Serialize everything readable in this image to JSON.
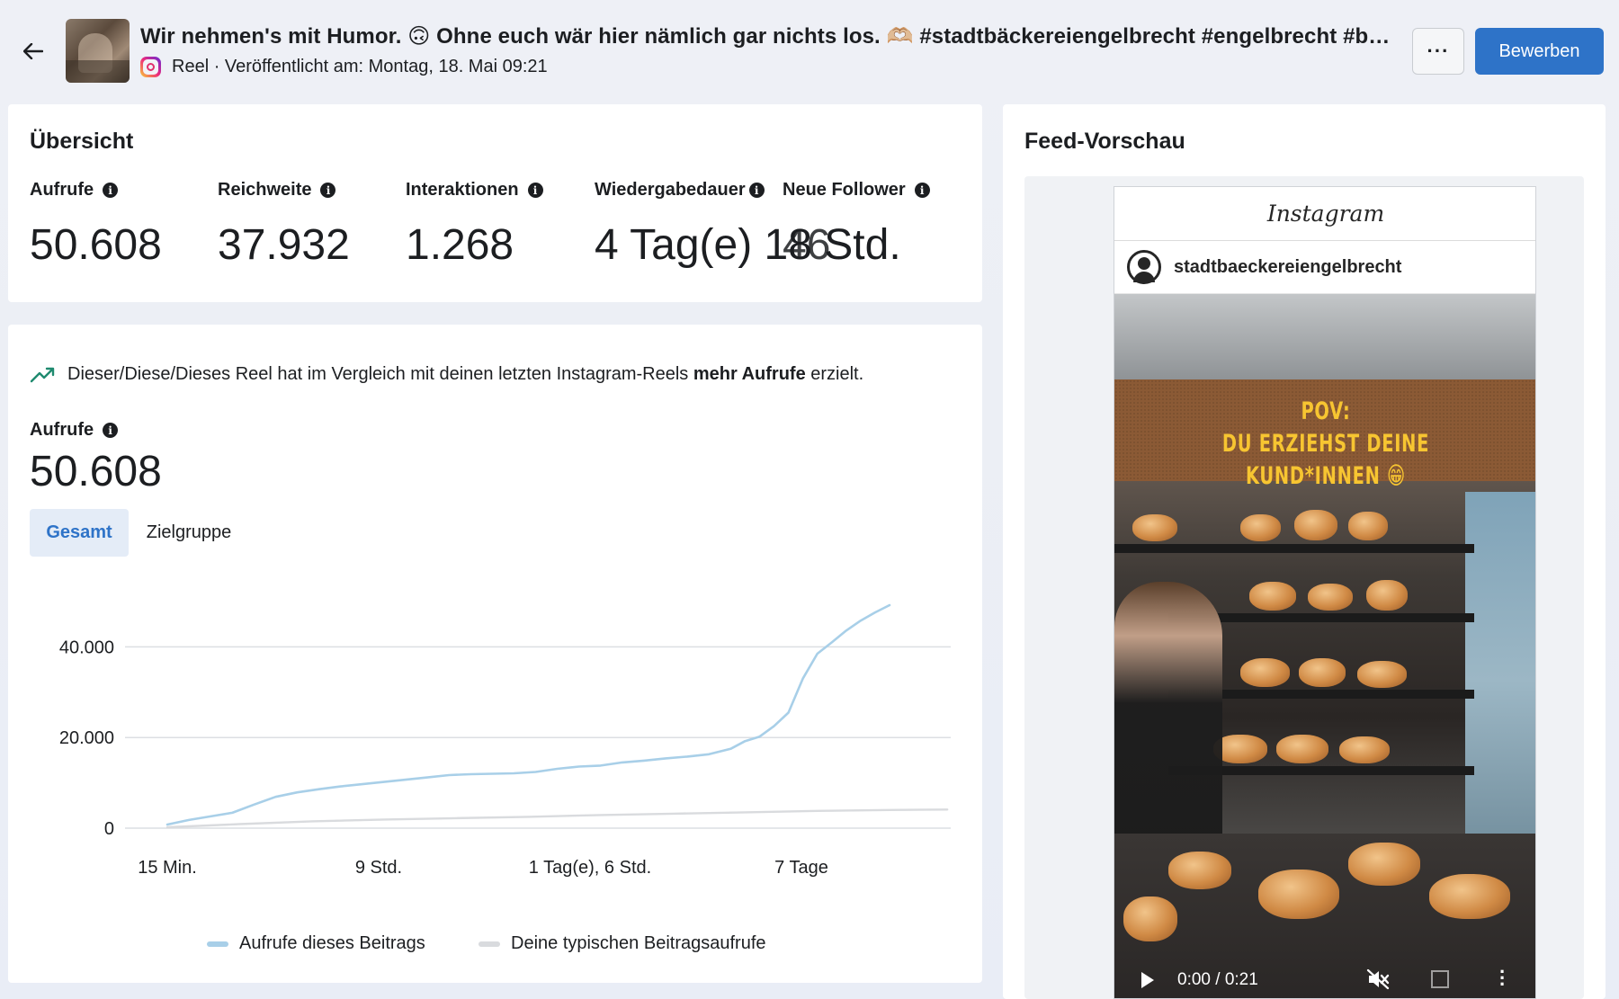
{
  "header": {
    "post_title": "Wir nehmen's mit Humor. 🙃 Ohne euch wär hier nämlich gar nichts los. 🫶🏼 #stadtbäckereiengelbrecht #engelbrecht #bremerha...",
    "meta": "Reel · Veröffentlicht am: Montag, 18. Mai 09:21",
    "more_label": "···",
    "apply_label": "Bewerben"
  },
  "overview": {
    "title": "Übersicht",
    "metrics": [
      {
        "label": "Aufrufe",
        "value": "50.608"
      },
      {
        "label": "Reichweite",
        "value": "37.932"
      },
      {
        "label": "Interaktionen",
        "value": "1.268"
      },
      {
        "label": "Wiedergabedauer",
        "value": "4 Tag(e) 18 Std."
      },
      {
        "label": "Neue Follower",
        "value": "46"
      }
    ]
  },
  "performance": {
    "trend_text_before": "Dieser/Diese/Dieses Reel hat im Vergleich mit deinen letzten Instagram-Reels",
    "trend_text_bold": "mehr Aufrufe",
    "trend_text_after": "erzielt.",
    "views_label": "Aufrufe",
    "views_value": "50.608",
    "tabs": [
      "Gesamt",
      "Zielgruppe"
    ],
    "active_tab": "Gesamt"
  },
  "chart_data": {
    "type": "line",
    "x_ticks": [
      "15 Min.",
      "9 Std.",
      "1 Tag(e), 6 Std.",
      "7 Tage"
    ],
    "y_ticks": [
      "0",
      "20.000",
      "40.000"
    ],
    "ylim": [
      0,
      50000
    ],
    "grid": true,
    "legend_position": "bottom",
    "series": [
      {
        "name": "Aufrufe dieses Beitrags",
        "color": "#a8cfe8",
        "x": [
          0,
          3,
          6,
          9,
          12,
          15,
          18,
          21,
          24,
          27,
          30,
          33,
          36,
          39,
          42,
          45,
          48,
          51,
          54,
          57,
          60,
          63,
          66,
          69,
          72,
          75,
          78,
          80,
          82,
          84,
          86,
          88,
          90,
          92,
          94,
          96,
          98,
          100
        ],
        "y": [
          800,
          1800,
          2600,
          3400,
          5200,
          6900,
          7900,
          8600,
          9200,
          9700,
          10200,
          10700,
          11200,
          11700,
          11900,
          12000,
          12100,
          12400,
          13100,
          13600,
          13800,
          14500,
          14900,
          15400,
          15800,
          16300,
          17500,
          19200,
          20200,
          22500,
          25500,
          33000,
          38500,
          41000,
          43600,
          45800,
          47600,
          49200
        ]
      },
      {
        "name": "Deine typischen Beitragsaufrufe",
        "color": "#d9dbde",
        "x": [
          0,
          10,
          20,
          30,
          40,
          50,
          60,
          70,
          80,
          90,
          100,
          108
        ],
        "y": [
          200,
          900,
          1500,
          1900,
          2200,
          2500,
          2900,
          3200,
          3500,
          3800,
          4000,
          4100
        ]
      }
    ]
  },
  "feed": {
    "title": "Feed-Vorschau",
    "app_name": "Instagram",
    "username": "stadtbaeckereiengelbrecht",
    "banner_line1": "POV:",
    "banner_line2": "DU ERZIEHST DEINE KUND*INNEN 😁",
    "time": "0:00 / 0:21"
  }
}
